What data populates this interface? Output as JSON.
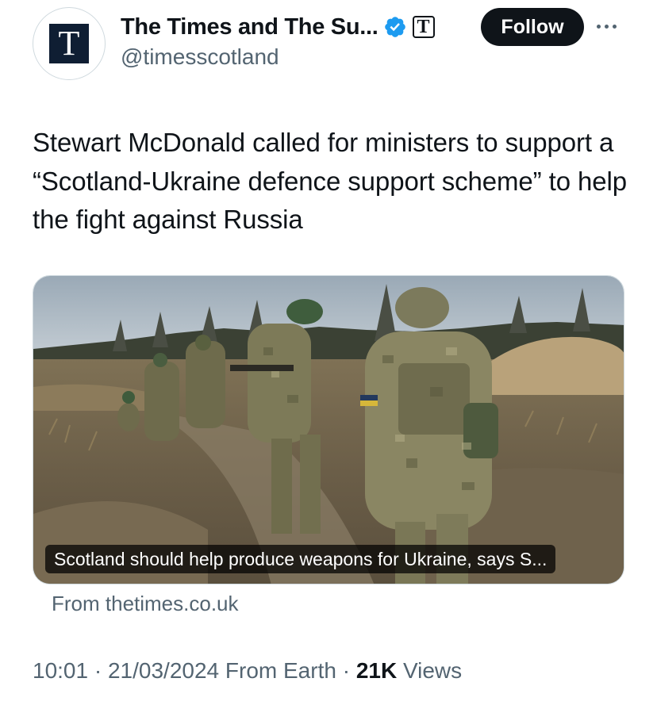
{
  "account": {
    "display_name": "The Times and The Su...",
    "handle": "@timesscotland",
    "avatar_letter": "T",
    "affiliate_letter": "T",
    "verified_color": "#1d9bf0"
  },
  "actions": {
    "follow_label": "Follow",
    "more_icon": "more-horizontal-icon"
  },
  "tweet": {
    "text": "Stewart McDonald called for ministers to support a “Scotland-Ukraine defence support scheme” to help the fight against Russia"
  },
  "link_card": {
    "caption": "Scotland should help produce weapons for Ukraine, says S...",
    "source": "From thetimes.co.uk"
  },
  "meta": {
    "time": "10:01",
    "separator1": " · ",
    "date": "21/03/2024",
    "client": " From Earth",
    "separator2": " · ",
    "views_count": "21K",
    "views_label": " Views"
  },
  "colors": {
    "text_primary": "#0f1419",
    "text_secondary": "#536471",
    "button_bg": "#0f1419"
  }
}
